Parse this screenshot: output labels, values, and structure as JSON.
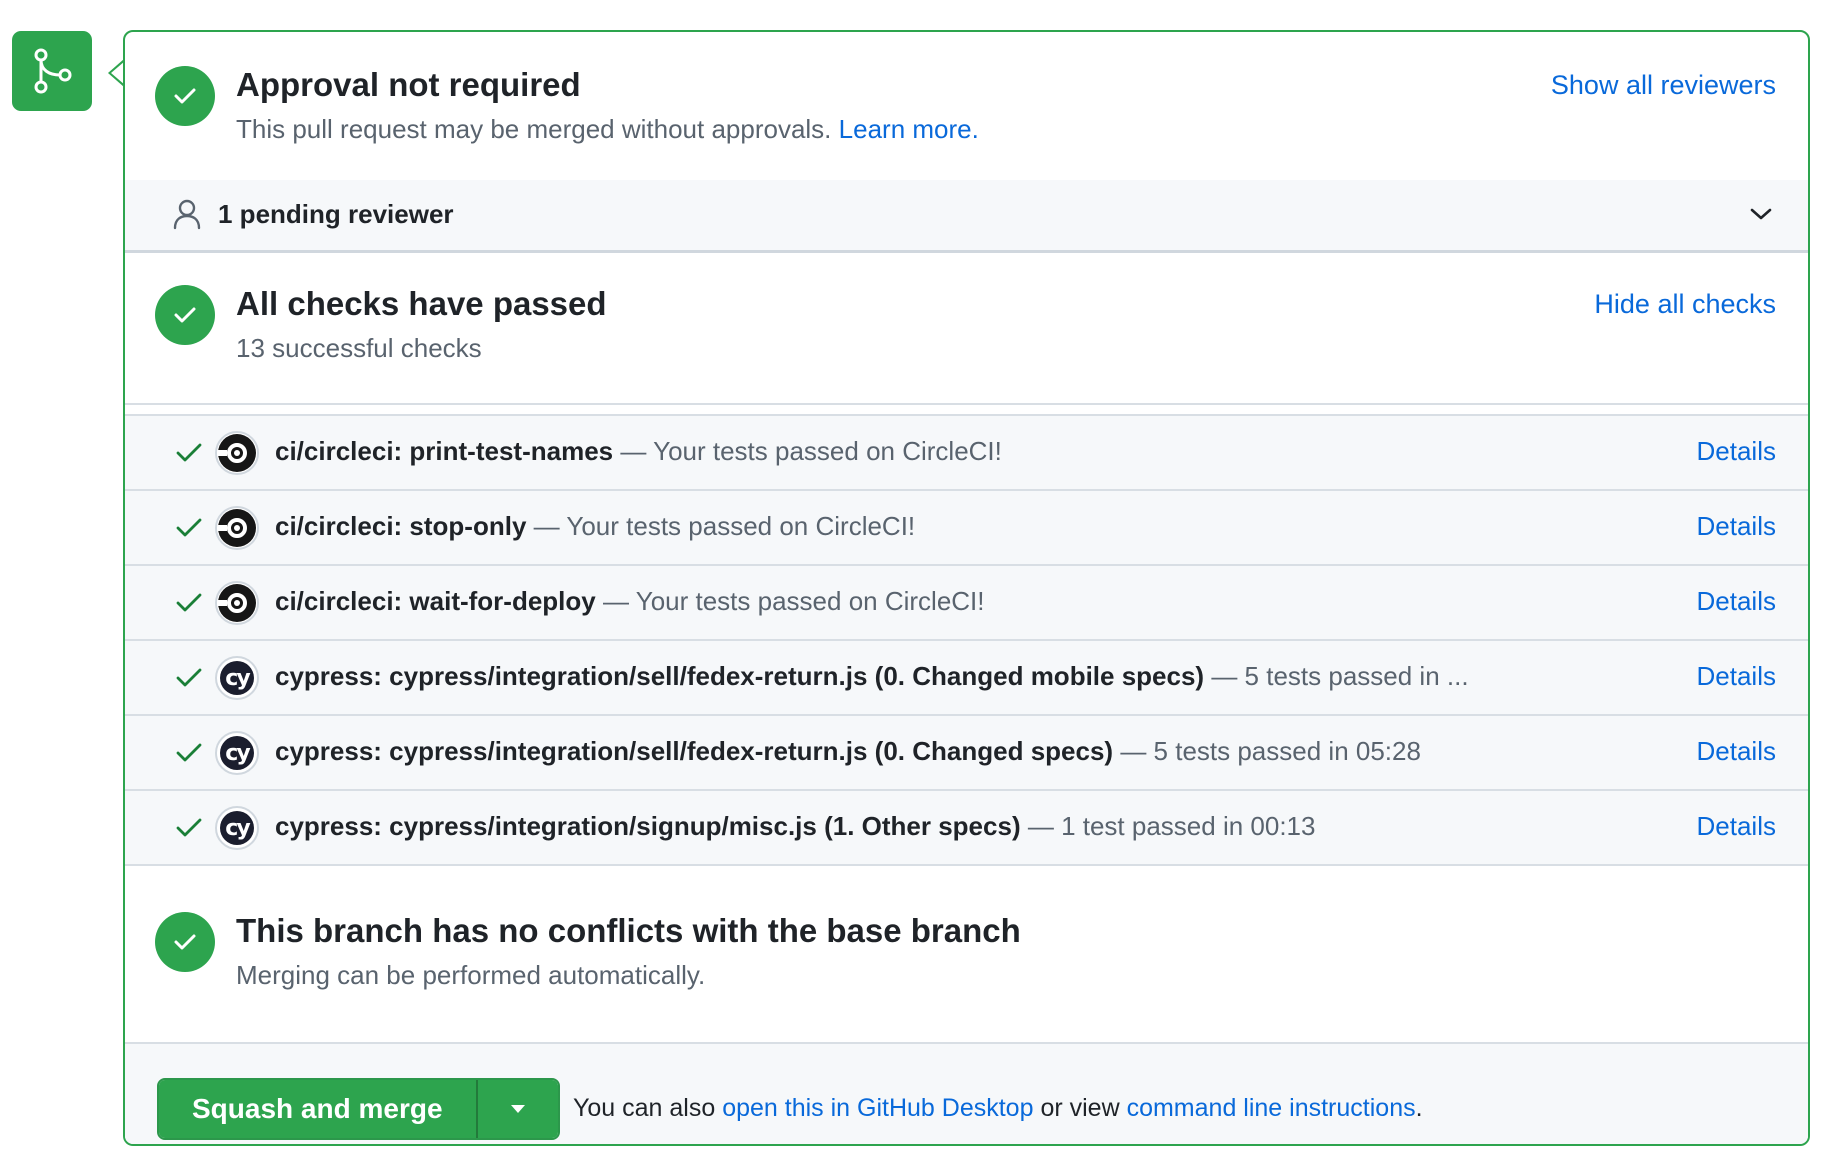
{
  "colors": {
    "success": "#2da44e",
    "link": "#0969da",
    "muted_text": "#59636e"
  },
  "approval": {
    "title": "Approval not required",
    "subtitle": "This pull request may be merged without approvals.",
    "learn_more": "Learn more.",
    "show_reviewers": "Show all reviewers"
  },
  "reviewers": {
    "pending_label": "1 pending reviewer"
  },
  "checks": {
    "title": "All checks have passed",
    "subtitle": "13 successful checks",
    "hide_link": "Hide all checks",
    "items": [
      {
        "icon": "circleci-icon",
        "name": "ci/circleci: print-test-names",
        "desc": "— Your tests passed on CircleCI!",
        "details": "Details"
      },
      {
        "icon": "circleci-icon",
        "name": "ci/circleci: stop-only",
        "desc": "— Your tests passed on CircleCI!",
        "details": "Details"
      },
      {
        "icon": "circleci-icon",
        "name": "ci/circleci: wait-for-deploy",
        "desc": "— Your tests passed on CircleCI!",
        "details": "Details"
      },
      {
        "icon": "cypress-icon",
        "name": "cypress: cypress/integration/sell/fedex-return.js (0. Changed mobile specs)",
        "desc": "— 5 tests passed in ...",
        "details": "Details"
      },
      {
        "icon": "cypress-icon",
        "name": "cypress: cypress/integration/sell/fedex-return.js (0. Changed specs)",
        "desc": "— 5 tests passed in 05:28",
        "details": "Details"
      },
      {
        "icon": "cypress-icon",
        "name": "cypress: cypress/integration/signup/misc.js (1. Other specs)",
        "desc": "— 1 test passed in 00:13",
        "details": "Details"
      }
    ]
  },
  "conflicts": {
    "title": "This branch has no conflicts with the base branch",
    "subtitle": "Merging can be performed automatically."
  },
  "merge": {
    "button_label": "Squash and merge",
    "also_prefix": "You can also",
    "desktop_link": "open this in GitHub Desktop",
    "or_view": "or view",
    "cli_link": "command line instructions",
    "suffix": "."
  },
  "cypress_glyph": "cy"
}
